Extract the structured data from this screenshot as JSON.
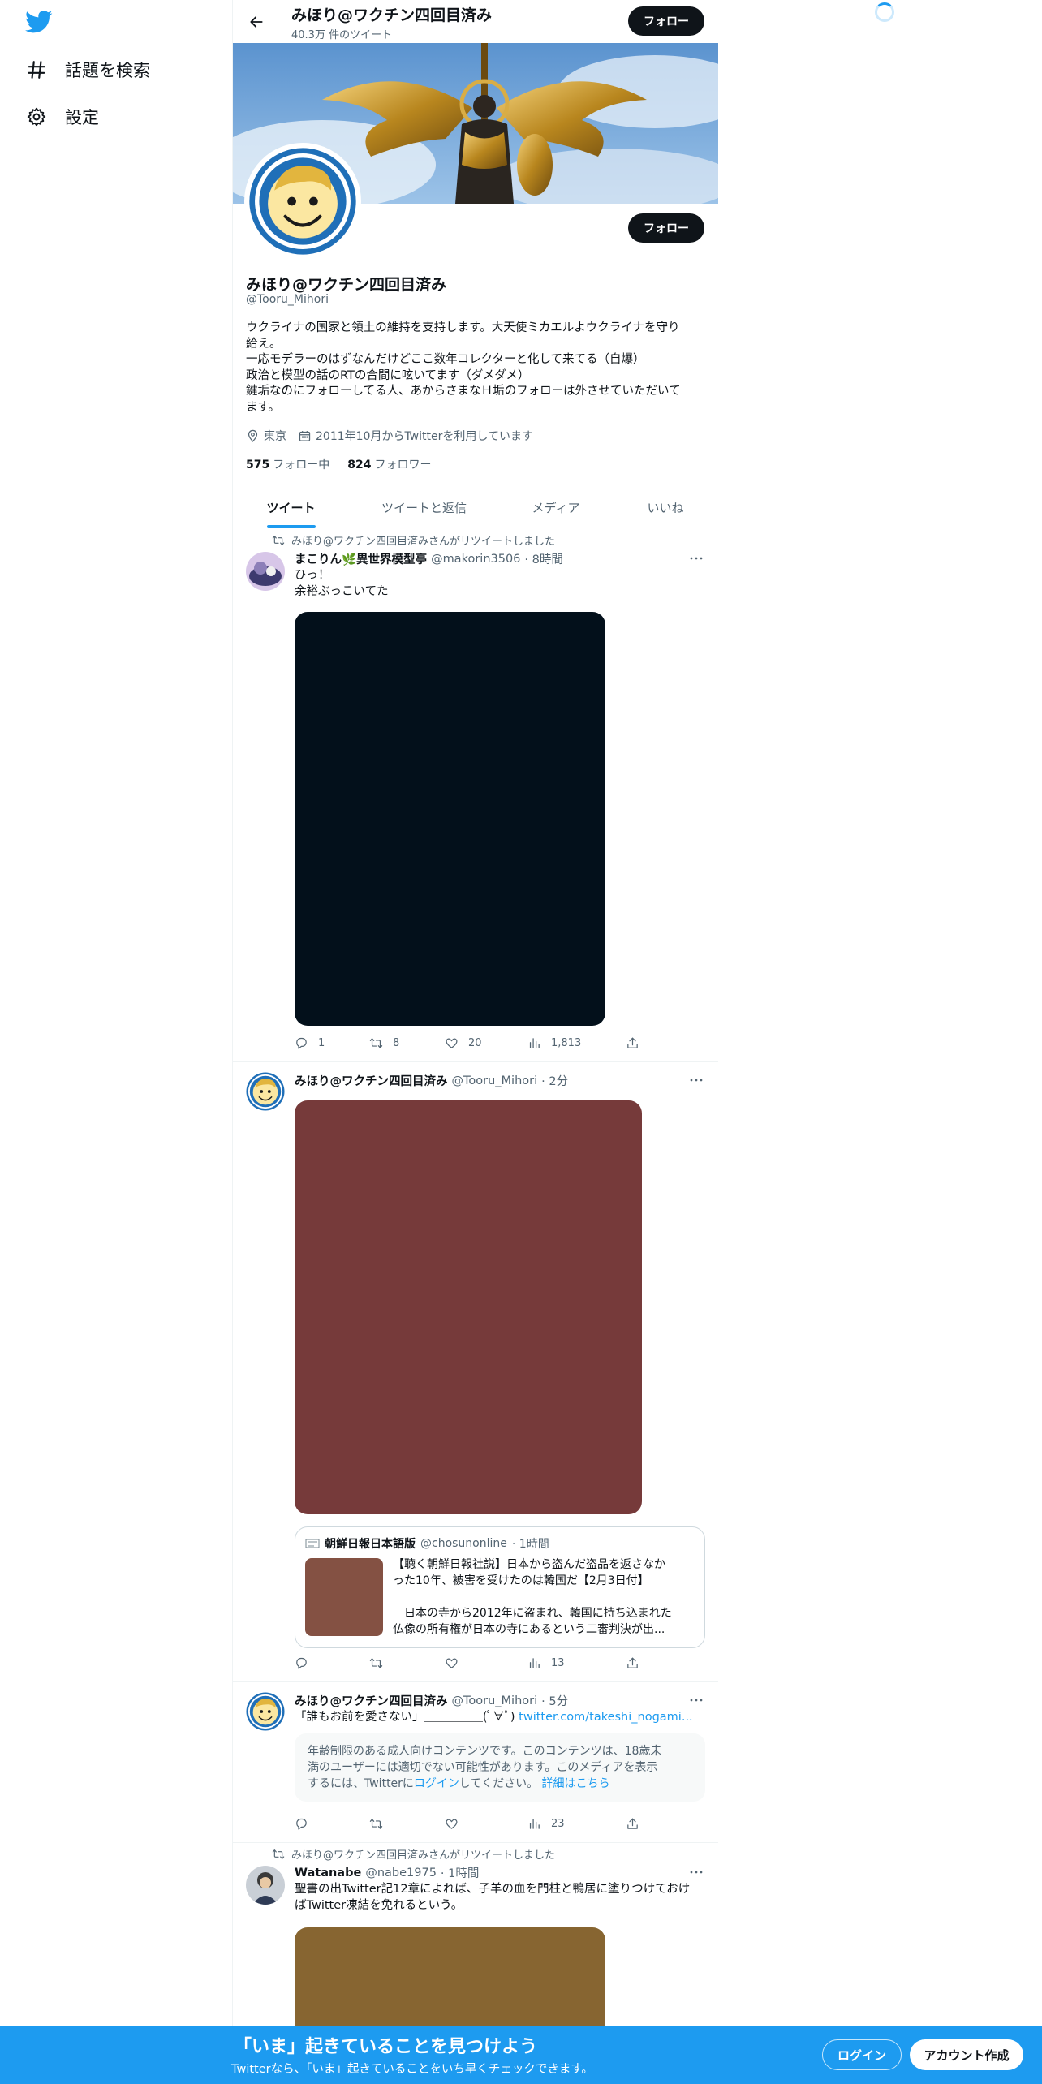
{
  "sidebar": {
    "logo_icon": "twitter-bird-icon",
    "items": [
      {
        "label": "話題を検索",
        "icon": "hashtag-icon"
      },
      {
        "label": "設定",
        "icon": "gear-icon"
      }
    ]
  },
  "header": {
    "name": "みほり@ワクチン四回目済み",
    "tweet_count": "40.3万 件のツイート",
    "follow_label": "フォロー"
  },
  "profile": {
    "name": "みほり@ワクチン四回目済み",
    "handle": "@Tooru_Mihori",
    "follow_label": "フォロー",
    "bio_lines": [
      "ウクライナの国家と領土の維持を支持します。大天使ミカエルよウクライナを守り",
      "給え。",
      "一応モデラーのはずなんだけどここ数年コレクターと化して来てる（自爆）",
      "政治と模型の話のRTの合間に呟いてます（ダメダメ）",
      "鍵垢なのにフォローしてる人、あからさまなＨ垢のフォローは外させていただいて",
      "ます。"
    ],
    "location": "東京",
    "joined": "2011年10月からTwitterを利用しています",
    "following_count": "575",
    "following_label": "フォロー中",
    "followers_count": "824",
    "followers_label": "フォロワー"
  },
  "tabs": [
    "ツイート",
    "ツイートと返信",
    "メディア",
    "いいね"
  ],
  "tweets": [
    {
      "retweet_label": "みほり@ワクチン四回目済みさんがリツイートしました",
      "name": "まこりん🌿異世界模型亭",
      "handle": "@makorin3506",
      "time": "· 8時間",
      "text_lines": [
        "ひっ！",
        "余裕ぶっこいてた"
      ],
      "media_color": "#03101b",
      "replies": "1",
      "retweets": "8",
      "likes": "20",
      "views": "1,813"
    },
    {
      "name": "みほり@ワクチン四回目済み",
      "handle": "@Tooru_Mihori",
      "time": "· 2分",
      "media_color": "#763a3a",
      "quote": {
        "name": "朝鮮日報日本語版",
        "handle": "@chosunonline",
        "time": "· 1時間",
        "text_lines": [
          "【聴く朝鮮日報社説】日本から盗んだ盗品を返さなか",
          "った10年、被害を受けたのは韓国だ【2月3日付】",
          "",
          "　日本の寺から2012年に盗まれ、韓国に持ち込まれた",
          "仏像の所有権が日本の寺にあるという二審判決が出..."
        ],
        "thumb_color": "#845143"
      },
      "views": "13"
    },
    {
      "name": "みほり@ワクチン四回目済み",
      "handle": "@Tooru_Mihori",
      "time": "· 5分",
      "text": "「誰もお前を愛さない」＿＿＿＿＿(ﾟ∀ﾟ) ",
      "link": "twitter.com/takeshi_nogami...",
      "sensitive_text_1": "年齢制限のある成人向けコンテンツです。このコンテンツは、18歳未",
      "sensitive_text_2": "満のユーザーには適切でない可能性があります。このメディアを表示",
      "sensitive_text_3a": "するには、Twitterに",
      "sensitive_login": "ログイン",
      "sensitive_text_3b": "してください。",
      "sensitive_more": "詳細はこちら",
      "views": "23"
    },
    {
      "retweet_label": "みほり@ワクチン四回目済みさんがリツイートしました",
      "name": "Watanabe",
      "handle": "@nabe1975",
      "time": "· 1時間",
      "text_lines": [
        "聖書の出Twitter記12章によれば、子羊の血を門柱と鴨居に塗りつけておけ",
        "ばTwitter凍結を免れるという。"
      ],
      "media_color": "#876531"
    }
  ],
  "bottom_bar": {
    "title": "「いま」起きていることを見つけよう",
    "subtitle": "Twitterなら、「いま」起きていることをいち早くチェックできます。",
    "login_label": "ログイン",
    "signup_label": "アカウント作成"
  },
  "colors": {
    "accent": "#1d9bf0",
    "text": "#0f1419",
    "muted": "#536471"
  }
}
